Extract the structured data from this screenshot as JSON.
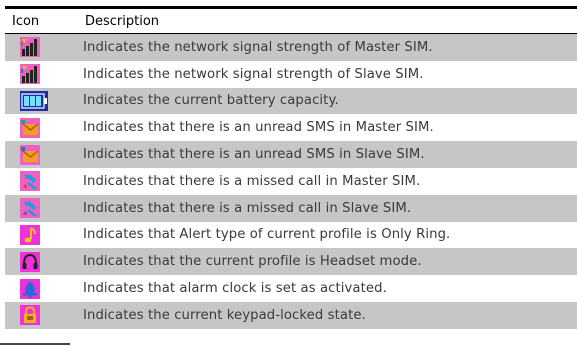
{
  "header": {
    "icon_label": "Icon",
    "description_label": "Description"
  },
  "rows": [
    {
      "icon": "signal-master-icon",
      "description": "Indicates the network signal strength of Master SIM."
    },
    {
      "icon": "signal-slave-icon",
      "description": "Indicates the network signal strength of Slave SIM."
    },
    {
      "icon": "battery-icon",
      "description": "Indicates the current battery capacity."
    },
    {
      "icon": "sms-master-icon",
      "description": "Indicates that there is an unread SMS in Master SIM."
    },
    {
      "icon": "sms-slave-icon",
      "description": "Indicates that there is an unread SMS in Slave SIM."
    },
    {
      "icon": "missed-call-master-icon",
      "description": "Indicates that there is a missed call in Master SIM."
    },
    {
      "icon": "missed-call-slave-icon",
      "description": "Indicates that there is a missed call in Slave SIM."
    },
    {
      "icon": "ring-only-icon",
      "description": "Indicates that Alert type of current profile is Only Ring."
    },
    {
      "icon": "headset-icon",
      "description": "Indicates that the current profile is Headset mode."
    },
    {
      "icon": "alarm-icon",
      "description": "Indicates that alarm clock is set as activated."
    },
    {
      "icon": "keypad-lock-icon",
      "description": "Indicates the current keypad-locked state."
    }
  ]
}
